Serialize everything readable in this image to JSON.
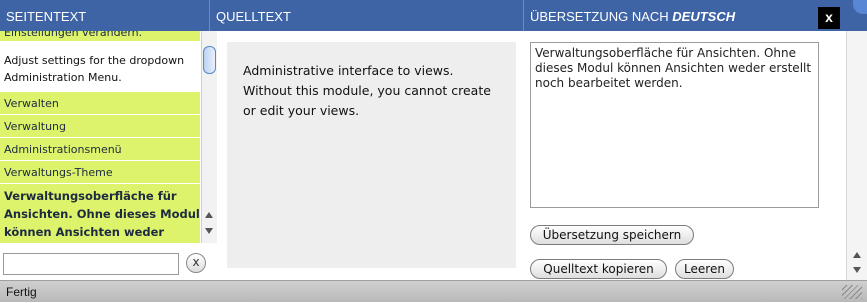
{
  "headers": {
    "page_text": "SEITENTEXT",
    "source_text": "QUELLTEXT",
    "translation_prefix": "ÜBERSETZUNG NACH ",
    "translation_lang": "DEUTSCH",
    "close": "x"
  },
  "sidebar": {
    "items": [
      {
        "label": "Einstellungen verändern."
      },
      {
        "label": "Adjust settings for the dropdown Administration Menu."
      },
      {
        "label": "Verwalten"
      },
      {
        "label": "Verwaltung"
      },
      {
        "label": "Administrationsmenü"
      },
      {
        "label": "Verwaltungs-Theme"
      },
      {
        "label": "Verwaltungsoberfläche für Ansichten. Ohne dieses Modul können Ansichten weder"
      }
    ],
    "search_value": "",
    "clear_icon": "x"
  },
  "source": {
    "text": "Administrative interface to views. Without this module, you cannot create or edit your views."
  },
  "translation": {
    "text": "Verwaltungsoberfläche für Ansichten. Ohne dieses Modul können Ansichten weder erstellt noch bearbeitet werden.",
    "save_label": "Übersetzung speichern",
    "copy_label": "Quelltext kopieren",
    "clear_label": "Leeren"
  },
  "status": {
    "text": "Fertig"
  },
  "colors": {
    "header_bg": "#3e64a6",
    "list_bg": "#ddf36b",
    "source_bg": "#eeeeee"
  }
}
